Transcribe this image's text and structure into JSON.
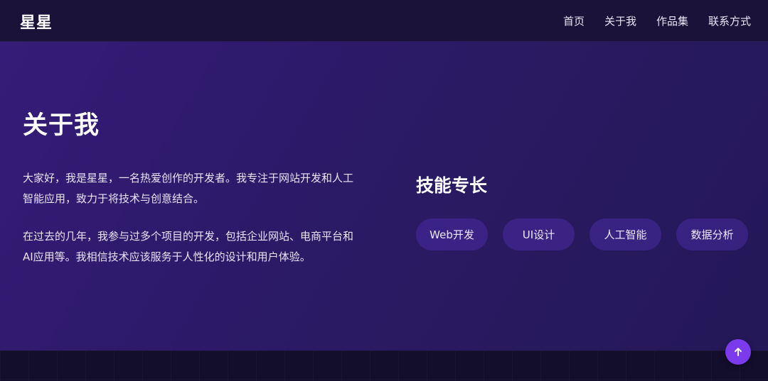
{
  "header": {
    "logo": "星星",
    "nav": [
      "首页",
      "关于我",
      "作品集",
      "联系方式"
    ]
  },
  "about": {
    "title": "关于我",
    "paragraphs": [
      "大家好，我是星星，一名热爱创作的开发者。我专注于网站开发和人工智能应用，致力于将技术与创意结合。",
      "在过去的几年，我参与过多个项目的开发，包括企业网站、电商平台和AI应用等。我相信技术应该服务于人性化的设计和用户体验。"
    ]
  },
  "skills": {
    "title": "技能专长",
    "tags": [
      "Web开发",
      "UI设计",
      "人工智能",
      "数据分析"
    ]
  },
  "back_to_top": {
    "icon": "arrow-up-icon",
    "color": "#7c3aed"
  }
}
